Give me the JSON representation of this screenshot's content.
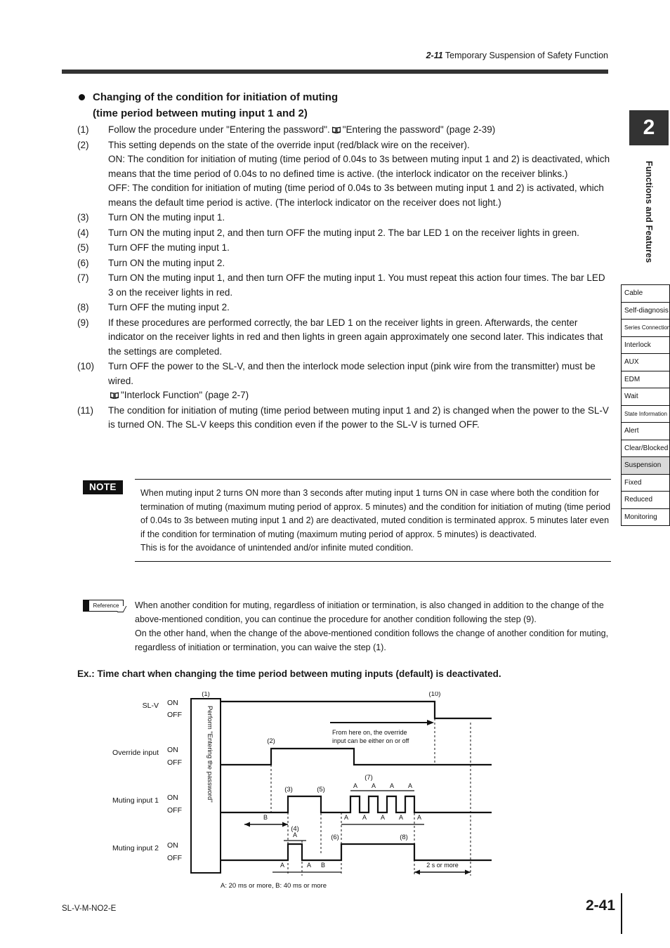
{
  "header": {
    "section_number": "2-11",
    "section_title": "Temporary Suspension of Safety Function"
  },
  "rail": {
    "chapter_number": "2",
    "chapter_title": "Functions and Features",
    "items": [
      {
        "label": "Cable",
        "active": false,
        "tiny": false
      },
      {
        "label": "Self-diagnosis",
        "active": false,
        "tiny": false
      },
      {
        "label": "Series Connection",
        "active": false,
        "tiny": true
      },
      {
        "label": "Interlock",
        "active": false,
        "tiny": false
      },
      {
        "label": "AUX",
        "active": false,
        "tiny": false
      },
      {
        "label": "EDM",
        "active": false,
        "tiny": false
      },
      {
        "label": "Wait",
        "active": false,
        "tiny": false
      },
      {
        "label": "State Information",
        "active": false,
        "tiny": true
      },
      {
        "label": "Alert",
        "active": false,
        "tiny": false
      },
      {
        "label": "Clear/Blocked",
        "active": false,
        "tiny": false
      },
      {
        "label": "Suspension",
        "active": true,
        "tiny": false
      },
      {
        "label": "Fixed",
        "active": false,
        "tiny": false
      },
      {
        "label": "Reduced",
        "active": false,
        "tiny": false
      },
      {
        "label": "Monitoring",
        "active": false,
        "tiny": false
      }
    ]
  },
  "main": {
    "heading_line1": "Changing of the condition for initiation of muting",
    "heading_line2": "(time period between muting input 1 and 2)",
    "steps": [
      {
        "num": "(1)",
        "text_before_icon": "Follow the procedure under \"Entering the password\".",
        "has_icon": true,
        "text_after_icon": "\"Entering the password\" (page 2-39)",
        "subs": []
      },
      {
        "num": "(2)",
        "text_before_icon": "This setting depends on the state of the override input (red/black wire on the receiver).",
        "has_icon": false,
        "text_after_icon": "",
        "subs": [
          "ON: The condition for initiation of muting (time period of 0.04s to 3s between muting input 1 and 2) is deactivated, which means that the time period of 0.04s to no defined time is active. (the interlock indicator on the receiver blinks.)",
          "OFF: The condition for initiation of muting (time period of 0.04s to 3s between muting input 1 and 2) is activated, which means the default time period is active. (The interlock indicator on the receiver does not light.)"
        ]
      },
      {
        "num": "(3)",
        "text_before_icon": "Turn ON the muting input 1.",
        "has_icon": false,
        "text_after_icon": "",
        "subs": []
      },
      {
        "num": "(4)",
        "text_before_icon": "Turn ON the muting input 2, and then turn OFF the muting input 2. The bar LED 1 on the receiver lights in green.",
        "has_icon": false,
        "text_after_icon": "",
        "subs": []
      },
      {
        "num": "(5)",
        "text_before_icon": "Turn OFF the muting input 1.",
        "has_icon": false,
        "text_after_icon": "",
        "subs": []
      },
      {
        "num": "(6)",
        "text_before_icon": "Turn ON the muting input 2.",
        "has_icon": false,
        "text_after_icon": "",
        "subs": []
      },
      {
        "num": "(7)",
        "text_before_icon": "Turn ON the muting input 1, and then turn OFF the muting input 1. You must repeat this action four times. The bar LED 3 on the receiver lights in red.",
        "has_icon": false,
        "text_after_icon": "",
        "subs": []
      },
      {
        "num": "(8)",
        "text_before_icon": "Turn OFF the muting input 2.",
        "has_icon": false,
        "text_after_icon": "",
        "subs": []
      },
      {
        "num": "(9)",
        "text_before_icon": "If these procedures are performed correctly, the bar LED 1 on the receiver lights in green. Afterwards, the center indicator on the receiver lights in red and then lights in green again approximately one second later. This indicates that the settings are completed.",
        "has_icon": false,
        "text_after_icon": "",
        "subs": []
      },
      {
        "num": "(10)",
        "text_before_icon": "Turn OFF the power to the SL-V, and then the interlock mode selection input (pink wire from the transmitter) must be wired.",
        "has_icon": false,
        "text_after_icon": "",
        "subs": [],
        "ref_line": {
          "has_icon": true,
          "text": "\"Interlock Function\" (page 2-7)"
        }
      },
      {
        "num": "(11)",
        "text_before_icon": "The condition for initiation of muting (time period between muting input 1 and 2) is changed when the power to the SL-V is turned ON. The SL-V keeps this condition even if the power to the SL-V is turned OFF.",
        "has_icon": false,
        "text_after_icon": "",
        "subs": []
      }
    ]
  },
  "note": {
    "label": "NOTE",
    "paragraphs": [
      "When muting input 2 turns ON more than 3 seconds after muting input 1 turns ON in case where both the condition for termination of muting (maximum muting period of approx. 5 minutes) and the condition for initiation of muting (time period of 0.04s to 3s between muting input 1 and 2) are deactivated, muted condition is terminated approx. 5 minutes later even if the condition for termination of muting (maximum muting period of approx. 5 minutes) is deactivated.",
      "This is for the avoidance of unintended and/or infinite muted condition."
    ]
  },
  "reference": {
    "label": "Reference",
    "paragraphs": [
      "When another condition for muting, regardless of initiation or termination, is also changed in addition to the change of the above-mentioned condition, you can continue the procedure for another condition following the step (9).",
      "On the other hand, when the change of the above-mentioned condition follows the change of another condition for muting, regardless of initiation or termination, you can waive the step (1)."
    ]
  },
  "example_title": "Ex.: Time chart when changing the time period between muting inputs (default) is deactivated.",
  "chart_data": {
    "type": "line",
    "title": "Time chart when changing the time period between muting inputs (default) is deactivated.",
    "signal_labels": [
      "SL-V",
      "Override input",
      "Muting input 1",
      "Muting input 2"
    ],
    "state_labels": [
      "ON",
      "OFF"
    ],
    "password_box_text": "Perform \"Entering the password\"",
    "legend_note": "A: 20 ms or more, B: 40 ms or more",
    "callout_text_line1": "From here on, the override",
    "callout_text_line2": "input can be either on or off",
    "step_markers": [
      "(1)",
      "(2)",
      "(3)",
      "(4)",
      "(5)",
      "(6)",
      "(7)",
      "(8)",
      "(10)"
    ],
    "interval_labels_muting1_top": [
      "A",
      "A",
      "A",
      "A"
    ],
    "interval_labels_muting1_bottom": [
      "A",
      "A",
      "A",
      "A",
      "A"
    ],
    "interval_label_B_muting1": "B",
    "interval_labels_muting2": [
      "A",
      "A",
      "B"
    ],
    "interval_label_muting2_pulse": "A",
    "interval_label_end": "2 s or more",
    "series": [
      {
        "name": "SL-V",
        "description": "ON from chart start (after password box) until marker (10), then OFF",
        "transitions": [
          {
            "t": "start",
            "state": "ON"
          },
          {
            "t": "(10)",
            "state": "OFF"
          }
        ]
      },
      {
        "name": "Override input",
        "description": "OFF until marker (2), ON from (2) until just before (10), then OFF",
        "transitions": [
          {
            "t": "start",
            "state": "OFF"
          },
          {
            "t": "(2)",
            "state": "ON"
          },
          {
            "t": "after (8)",
            "state": "OFF"
          }
        ]
      },
      {
        "name": "Muting input 1",
        "description": "OFF, single pulse ON at (3) to (5), then four short pulses at (7)",
        "transitions": [
          {
            "t": "start",
            "state": "OFF"
          },
          {
            "t": "(3)",
            "state": "ON"
          },
          {
            "t": "(5)",
            "state": "OFF"
          },
          {
            "t": "(7) pulse train",
            "state": "4 pulses"
          }
        ]
      },
      {
        "name": "Muting input 2",
        "description": "OFF, short pulse at (4), ON from (6) until (8), then OFF",
        "transitions": [
          {
            "t": "start",
            "state": "OFF"
          },
          {
            "t": "(4)",
            "state": "pulse"
          },
          {
            "t": "(6)",
            "state": "ON"
          },
          {
            "t": "(8)",
            "state": "OFF"
          }
        ]
      }
    ]
  },
  "footer": {
    "document_code": "SL-V-M-NO2-E",
    "page_number": "2-41"
  }
}
